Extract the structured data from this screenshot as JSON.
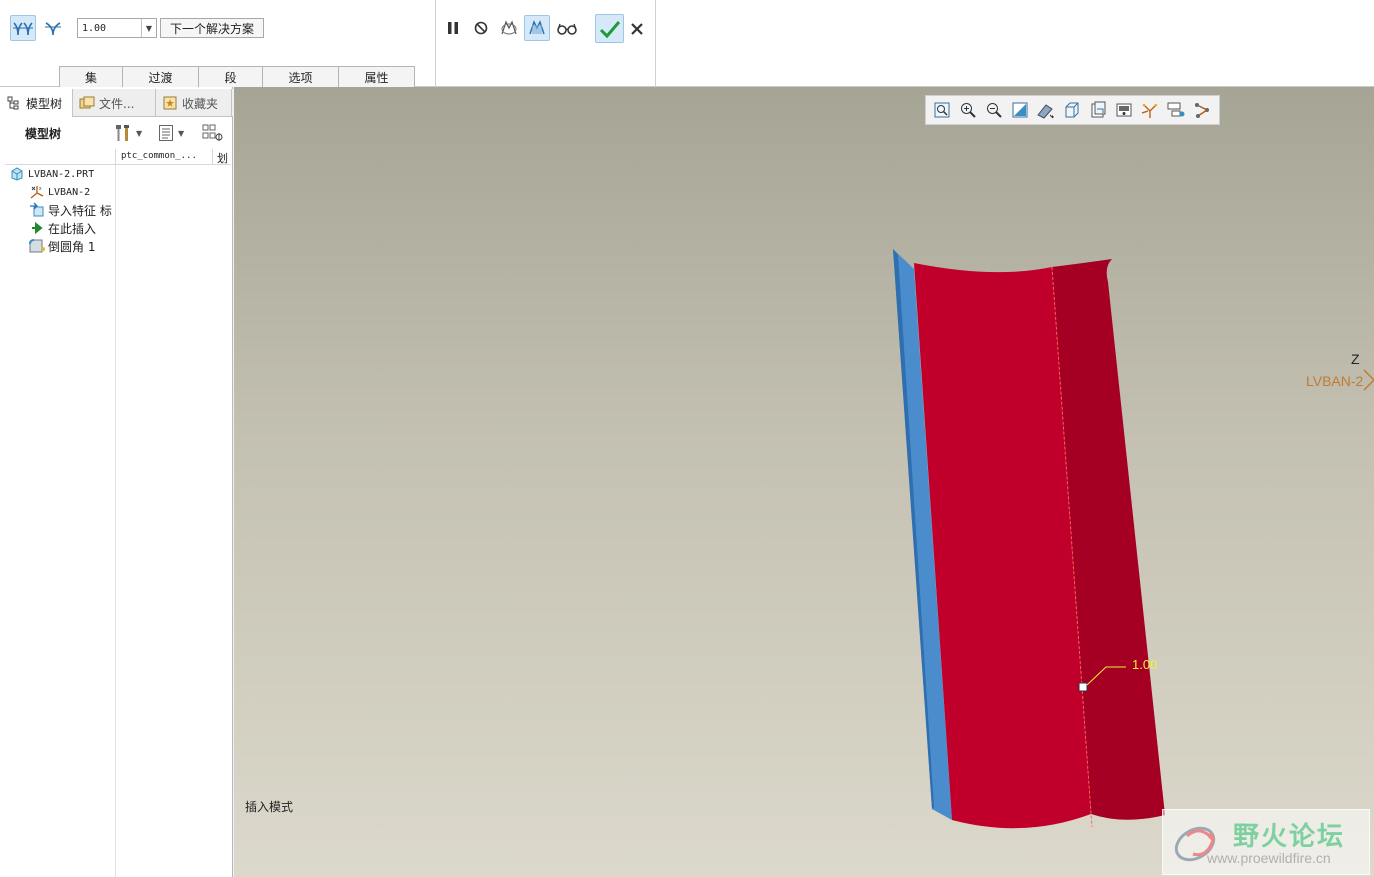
{
  "dashboard": {
    "radius_value": "1.00",
    "next_solution_label": "下一个解决方案",
    "tabs": [
      {
        "label": "集"
      },
      {
        "label": "过渡"
      },
      {
        "label": "段"
      },
      {
        "label": "选项"
      },
      {
        "label": "属性"
      }
    ]
  },
  "navigator": {
    "tabs": [
      {
        "label": "模型树",
        "icon": "model-tree-icon"
      },
      {
        "label": "文件...",
        "icon": "folder-browser-icon"
      },
      {
        "label": "收藏夹",
        "icon": "favorites-icon"
      }
    ],
    "tree_title": "模型树",
    "columns": {
      "ptc": "ptc_common_...",
      "extra": "划"
    },
    "items": [
      {
        "label": "LVBAN-2.PRT",
        "icon": "part-icon"
      },
      {
        "label": "LVBAN-2",
        "icon": "csys-icon"
      },
      {
        "label": "导入特征 标",
        "icon": "import-feature-icon"
      },
      {
        "label": "在此插入",
        "icon": "insert-here-arrow-icon"
      },
      {
        "label": "倒圆角 1",
        "icon": "round-feature-icon"
      }
    ]
  },
  "graphics": {
    "mode_text": "插入模式",
    "csys_axis_label": "Z",
    "csys_name": "LVBAN-2",
    "dimension_value": "1.00",
    "watermark_title": "野火论坛",
    "watermark_url": "www.proewildfire.cn"
  },
  "colors": {
    "surface_main": "#c0002a",
    "surface_side": "#a50023",
    "surface_edge": "#4a8ccc",
    "accent_check": "#1f9a3a",
    "dimension": "#f0ef3c",
    "csys_name": "#c27b32"
  }
}
